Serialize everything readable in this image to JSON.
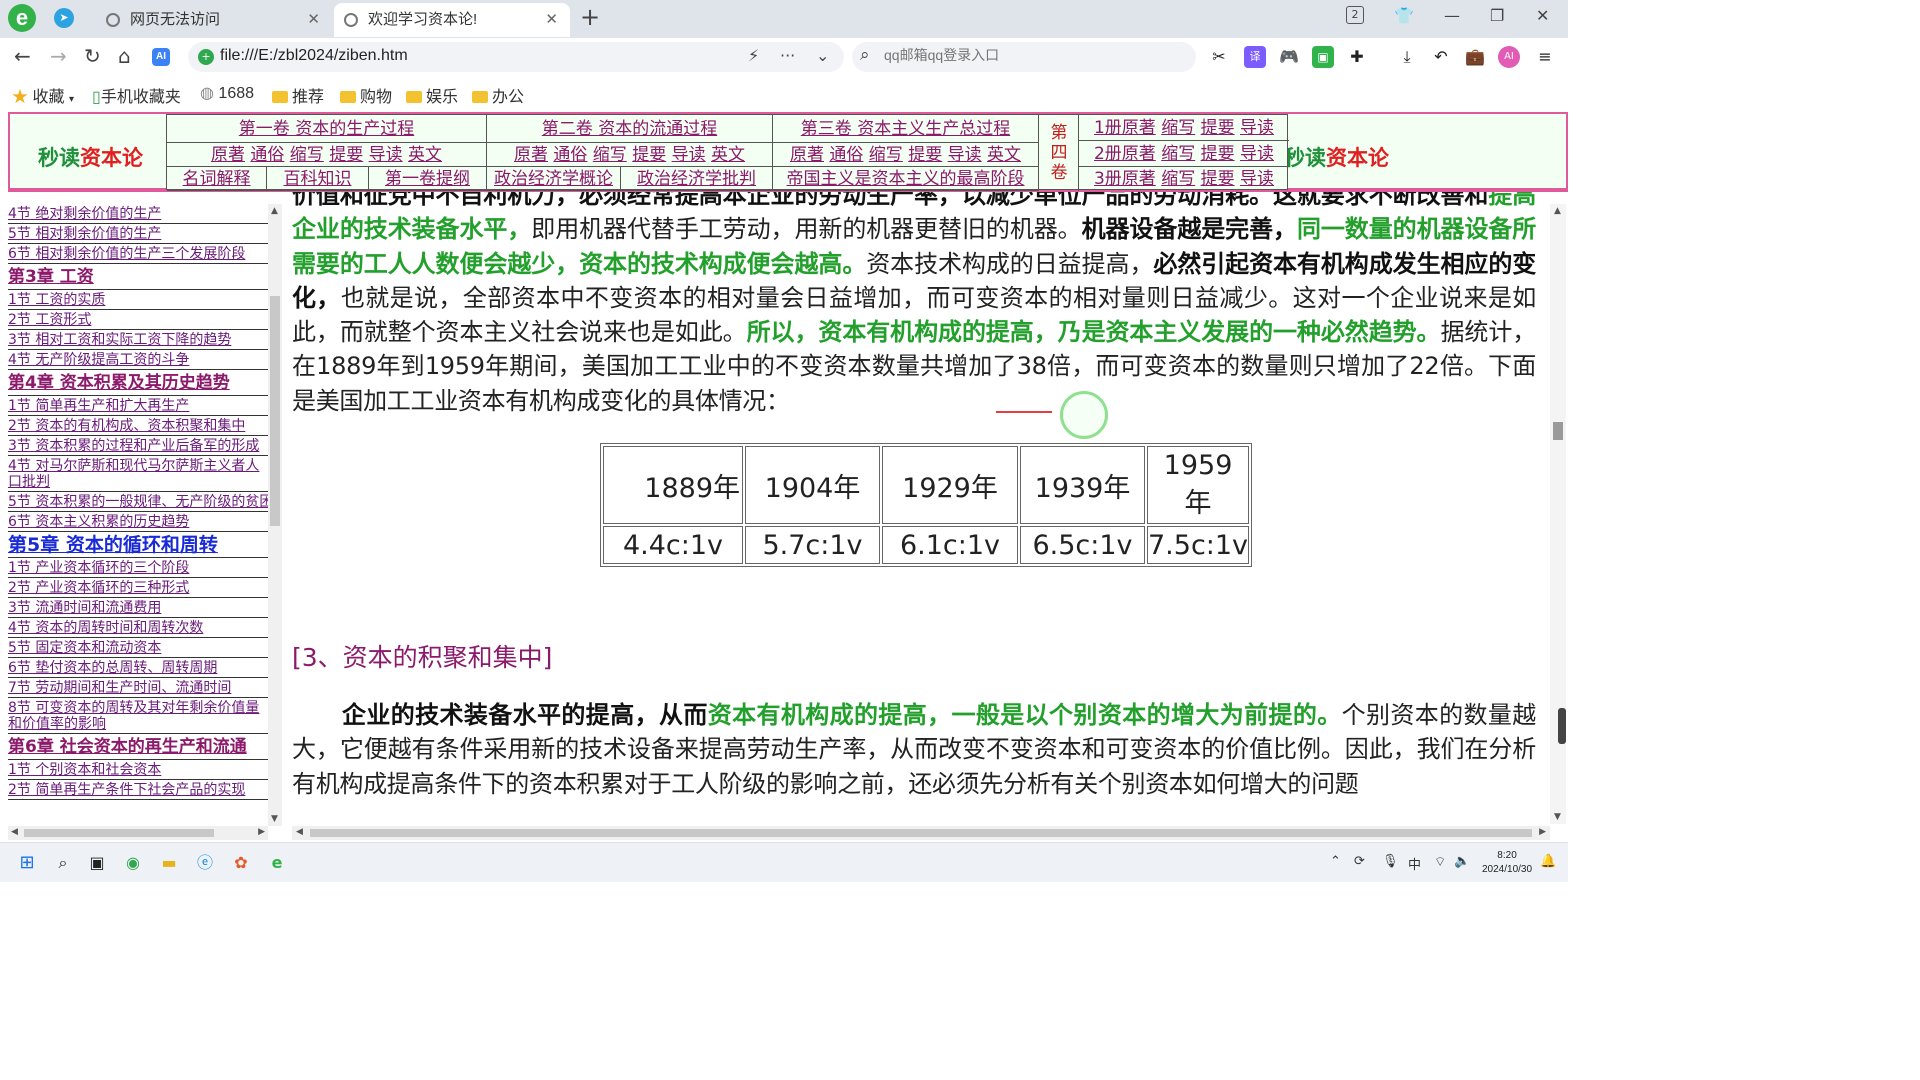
{
  "browser": {
    "tabs": [
      {
        "title": "网页无法访问",
        "active": false
      },
      {
        "title": "欢迎学习资本论!",
        "active": true
      }
    ],
    "tab_counter": "2",
    "url": "file:///E:/zbl2024/ziben.htm",
    "search_placeholder": "qq邮箱qq登录入口",
    "bookmarks": [
      "收藏",
      "手机收藏夹",
      "1688",
      "推荐",
      "购物",
      "娱乐",
      "办公"
    ]
  },
  "site_header": {
    "brand_green": "秒读",
    "brand_red": "资本论",
    "volumes": [
      "第一卷 资本的生产过程",
      "第二卷 资本的流通过程",
      "第三卷 资本主义生产总过程"
    ],
    "volume_links": [
      "原著",
      "通俗",
      "缩写",
      "提要",
      "导读",
      "英文"
    ],
    "extras": [
      "名词解释",
      "百科知识",
      "第一卷提纲",
      "政治经济学概论",
      "政治经济学批判",
      "帝国主义是资本主义的最高阶段"
    ],
    "volume4": [
      "第",
      "四",
      "卷"
    ],
    "books": [
      "1册原著",
      "2册原著",
      "3册原著"
    ],
    "book_links": [
      "缩写",
      "提要",
      "导读"
    ]
  },
  "sidebar": {
    "items": [
      {
        "text": "4节  绝对剩余价值的生产",
        "kind": "sec"
      },
      {
        "text": "5节  相对剩余价值的生产",
        "kind": "sec"
      },
      {
        "text": "6节  相对剩余价值的生产三个发展阶段",
        "kind": "sec"
      },
      {
        "text": "第3章 工资",
        "kind": "ch"
      },
      {
        "text": "1节 工资的实质",
        "kind": "sec"
      },
      {
        "text": "2节 工资形式",
        "kind": "sec"
      },
      {
        "text": "3节 相对工资和实际工资下降的趋势",
        "kind": "sec"
      },
      {
        "text": "4节 无产阶级提高工资的斗争",
        "kind": "sec"
      },
      {
        "text": "第4章 资本积累及其历史趋势",
        "kind": "ch"
      },
      {
        "text": "1节 简单再生产和扩大再生产",
        "kind": "sec"
      },
      {
        "text": "2节 资本的有机构成、资本积聚和集中",
        "kind": "sec"
      },
      {
        "text": "3节 资本积累的过程和产业后备军的形成",
        "kind": "sec"
      },
      {
        "text": "4节 对马尔萨斯和现代马尔萨斯主义者人口批判",
        "kind": "sec-wrap"
      },
      {
        "text": "5节 资本积累的一般规律、无产阶级的贫困",
        "kind": "sec"
      },
      {
        "text": "6节 资本主义积累的历史趋势",
        "kind": "sec"
      },
      {
        "text": "第5章 资本的循环和周转",
        "kind": "ch-current"
      },
      {
        "text": "1节 产业资本循环的三个阶段",
        "kind": "sec"
      },
      {
        "text": "2节 产业资本循环的三种形式",
        "kind": "sec"
      },
      {
        "text": "3节 流通时间和流通费用",
        "kind": "sec"
      },
      {
        "text": "4节 资本的周转时间和周转次数",
        "kind": "sec"
      },
      {
        "text": "5节 固定资本和流动资本",
        "kind": "sec"
      },
      {
        "text": "6节 垫付资本的总周转、周转周期",
        "kind": "sec"
      },
      {
        "text": "7节 劳动期间和生产时间、流通时间",
        "kind": "sec"
      },
      {
        "text": "8节 可变资本的周转及其对年剩余价值量和价值率的影响",
        "kind": "sec-wrap"
      },
      {
        "text": "第6章 社会资本的再生产和流通",
        "kind": "ch"
      },
      {
        "text": "1节 个别资本和社会资本",
        "kind": "sec"
      },
      {
        "text": "2节 简单再生产条件下社会产品的实现",
        "kind": "sec"
      }
    ]
  },
  "content": {
    "para1": [
      {
        "t": "价值和征党中不自利机力，必须经常提高本企业的劳动生产率，以减少单位产品的劳动消耗。这就要求不断改",
        "s": "b"
      },
      {
        "t": "善和",
        "s": "b"
      },
      {
        "t": "提高企业的技术装备水平，",
        "s": "g"
      },
      {
        "t": "即用机器代替手工劳动，用新的机器更替旧的机器。",
        "s": "n"
      },
      {
        "t": "机器设备越是完善，",
        "s": "b"
      },
      {
        "t": "同一数量的机器设备所需要的工人人数便会越少，资本的技术构成便会越高。",
        "s": "g"
      },
      {
        "t": "资本技术构成的日益提高，",
        "s": "n"
      },
      {
        "t": "必然引起资本有机构成发生相应的变化，",
        "s": "b"
      },
      {
        "t": "也就是说，全部资本中不变资本的相对量会日益增加，而可变资本的相对量则日益减少。这对一个企业说来是如此，而就整个资本主义社会说来也是如此。",
        "s": "n"
      },
      {
        "t": "所以，资本有机构成的提高，乃是资本主义发展的一种必然趋势。",
        "s": "g"
      },
      {
        "t": "据统计，在1889年到1959年期间，美国加工工业中的不变资本数量共增加了38倍，而可变资本的数量则只增加了22倍。下面是美国加工工业资本有机构成变化的具体情况：",
        "s": "n"
      }
    ],
    "table": {
      "years": [
        "1889年",
        "1904年",
        "1929年",
        "1939年",
        "1959年"
      ],
      "ratios": [
        "4.4c:1v",
        "5.7c:1v",
        "6.1c:1v",
        "6.5c:1v",
        "7.5c:1v"
      ]
    },
    "subheading": "[3、资本的积聚和集中]",
    "para2": [
      {
        "t": "企业的技术装备水平的提高，从而",
        "s": "b"
      },
      {
        "t": "资本有机构成的提高，一般是以个别资本的增大为前提的。",
        "s": "g"
      },
      {
        "t": "个别资本的数量越大，它便越有条件采用新的技术设备来提高劳动生产率，从而改变不变资本和可变资本的价值比例。因此，我们在分析有机构成提高条件下的资本积累对于工人阶级的影响之前，还必须先分析有关个别资本如何增大的问题",
        "s": "n"
      }
    ]
  },
  "taskbar": {
    "time": "8:20",
    "date": "2024/10/30",
    "ime": "中"
  }
}
